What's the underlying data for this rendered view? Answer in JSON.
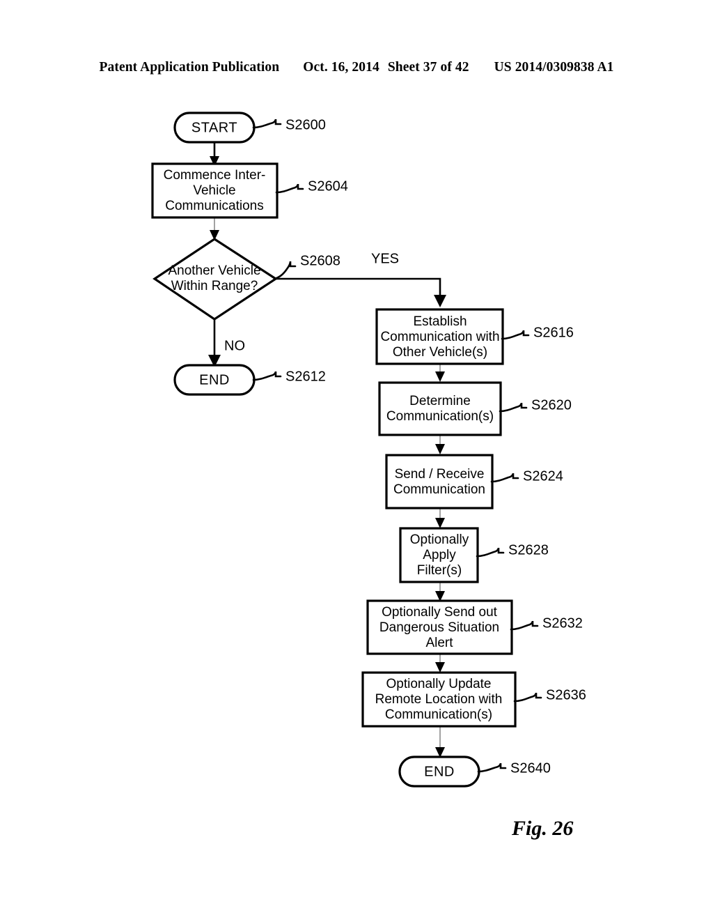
{
  "header": {
    "publication": "Patent Application Publication",
    "date": "Oct. 16, 2014",
    "sheet": "Sheet 37 of 42",
    "patent_number": "US 2014/0309838 A1"
  },
  "figure": {
    "caption": "Fig. 26"
  },
  "flowchart": {
    "nodes": {
      "start": {
        "label": "START",
        "ref": "S2600"
      },
      "commence": {
        "line1": "Commence Inter-",
        "line2": "Vehicle",
        "line3": "Communications",
        "ref": "S2604"
      },
      "decision": {
        "line1": "Another Vehicle",
        "line2": "Within Range?",
        "ref": "S2608"
      },
      "end_no": {
        "label": "END",
        "ref": "S2612"
      },
      "establish": {
        "line1": "Establish",
        "line2": "Communication with",
        "line3": "Other Vehicle(s)",
        "ref": "S2616"
      },
      "determine": {
        "line1": "Determine",
        "line2": "Communication(s)",
        "ref": "S2620"
      },
      "send_receive": {
        "line1": "Send / Receive",
        "line2": "Communication",
        "ref": "S2624"
      },
      "filters": {
        "line1": "Optionally",
        "line2": "Apply",
        "line3": "Filter(s)",
        "ref": "S2628"
      },
      "alert": {
        "line1": "Optionally Send out",
        "line2": "Dangerous Situation",
        "line3": "Alert",
        "ref": "S2632"
      },
      "update_remote": {
        "line1": "Optionally Update",
        "line2": "Remote Location with",
        "line3": "Communication(s)",
        "ref": "S2636"
      },
      "end_yes": {
        "label": "END",
        "ref": "S2640"
      }
    },
    "branch_labels": {
      "yes": "YES",
      "no": "NO"
    },
    "colors": {
      "stroke": "#000000",
      "thin_connector": "#8a8a8a",
      "fill": "#ffffff"
    }
  }
}
